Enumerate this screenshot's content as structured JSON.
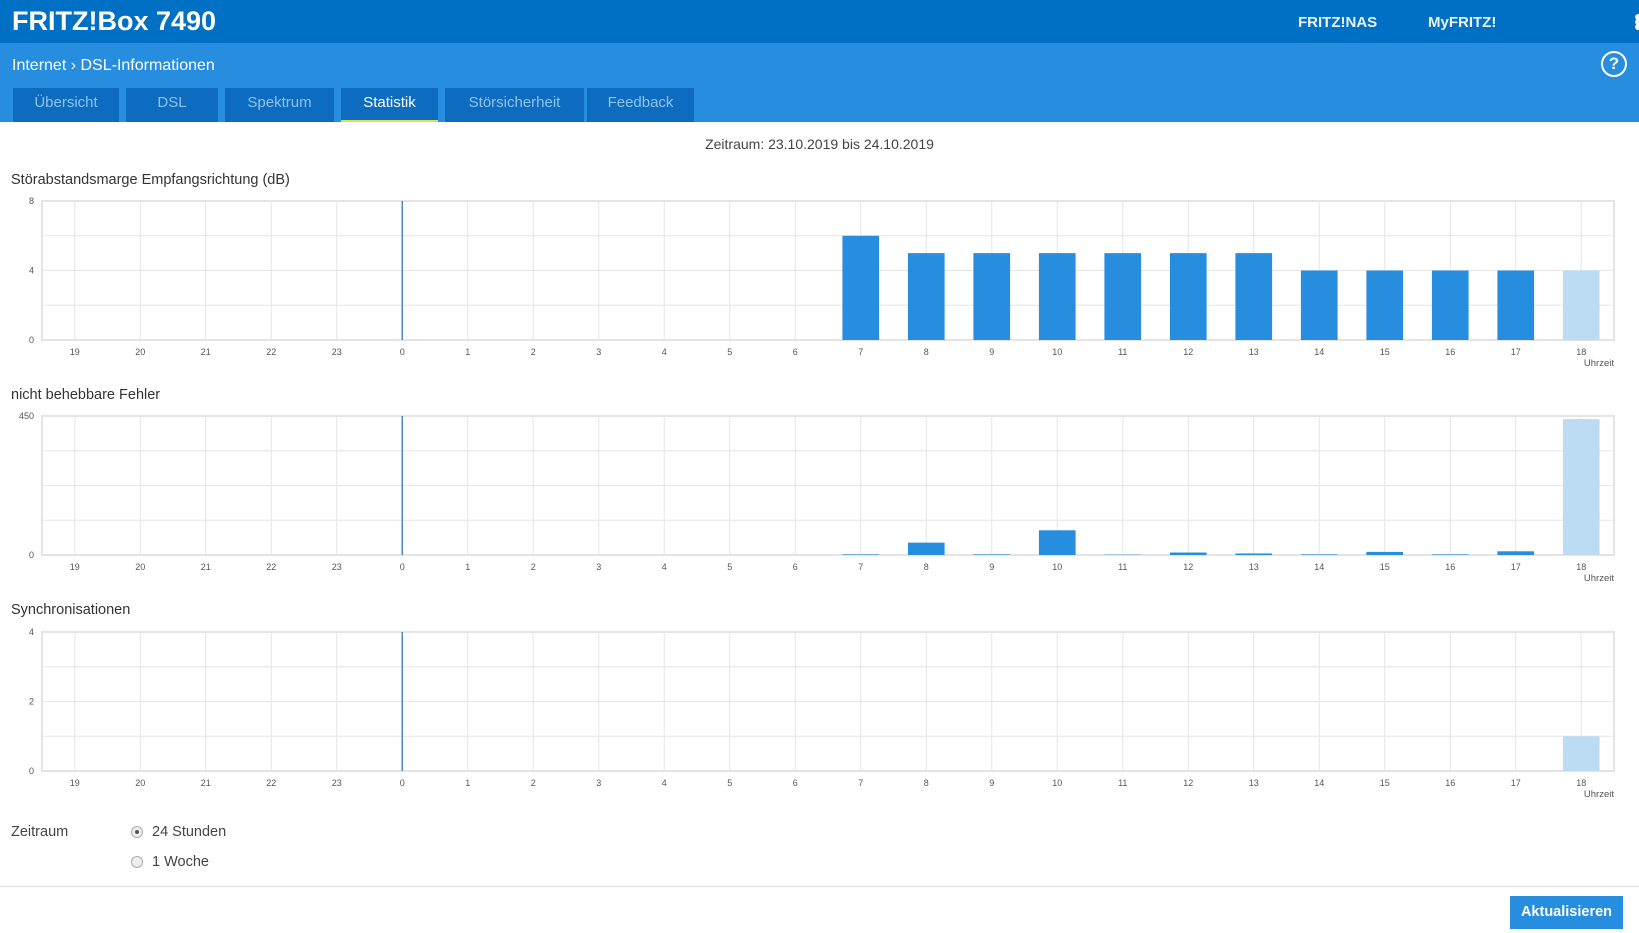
{
  "header": {
    "brand": "FRITZ!Box 7490",
    "links": [
      "FRITZ!NAS",
      "MyFRITZ!"
    ]
  },
  "breadcrumb": {
    "parent": "Internet",
    "separator": "›",
    "current": "DSL-Informationen"
  },
  "tabs": [
    {
      "label": "Übersicht"
    },
    {
      "label": "DSL"
    },
    {
      "label": "Spektrum"
    },
    {
      "label": "Statistik",
      "active": true
    },
    {
      "label": "Störsicherheit"
    },
    {
      "label": "Feedback"
    }
  ],
  "period_text": "Zeitraum: 23.10.2019 bis 24.10.2019",
  "colors": {
    "bar": "#278dde",
    "current": "#bcdcf4",
    "midnight": "#4a8ac4"
  },
  "chart_data": [
    {
      "type": "bar",
      "title": "Störabstandsmarge Empfangsrichtung (dB)",
      "xlabel": "Uhrzeit",
      "ylim": [
        0,
        8
      ],
      "yticks": [
        "0",
        "4",
        "8"
      ],
      "categories": [
        "19",
        "20",
        "21",
        "22",
        "23",
        "0",
        "1",
        "2",
        "3",
        "4",
        "5",
        "6",
        "7",
        "8",
        "9",
        "10",
        "11",
        "12",
        "13",
        "14",
        "15",
        "16",
        "17",
        "18"
      ],
      "values": [
        0,
        0,
        0,
        0,
        0,
        0,
        0,
        0,
        0,
        0,
        0,
        0,
        6,
        5,
        5,
        5,
        5,
        5,
        5,
        4,
        4,
        4,
        4,
        4
      ],
      "current_index": 23
    },
    {
      "type": "bar",
      "title": "nicht behebbare Fehler",
      "xlabel": "Uhrzeit",
      "ylim": [
        0,
        450
      ],
      "yticks": [
        "0",
        "450"
      ],
      "categories": [
        "19",
        "20",
        "21",
        "22",
        "23",
        "0",
        "1",
        "2",
        "3",
        "4",
        "5",
        "6",
        "7",
        "8",
        "9",
        "10",
        "11",
        "12",
        "13",
        "14",
        "15",
        "16",
        "17",
        "18"
      ],
      "values": [
        0,
        0,
        0,
        0,
        0,
        0,
        0,
        0,
        0,
        0,
        0,
        0,
        2,
        40,
        2,
        80,
        1,
        8,
        5,
        2,
        10,
        2,
        12,
        440
      ],
      "current_index": 23
    },
    {
      "type": "bar",
      "title": "Synchronisationen",
      "xlabel": "Uhrzeit",
      "ylim": [
        0,
        4
      ],
      "yticks": [
        "0",
        "2",
        "4"
      ],
      "categories": [
        "19",
        "20",
        "21",
        "22",
        "23",
        "0",
        "1",
        "2",
        "3",
        "4",
        "5",
        "6",
        "7",
        "8",
        "9",
        "10",
        "11",
        "12",
        "13",
        "14",
        "15",
        "16",
        "17",
        "18"
      ],
      "values": [
        0,
        0,
        0,
        0,
        0,
        0,
        0,
        0,
        0,
        0,
        0,
        0,
        0,
        0,
        0,
        0,
        0,
        0,
        0,
        0,
        0,
        0,
        0,
        1
      ],
      "current_index": 23
    }
  ],
  "zeitraum": {
    "label": "Zeitraum",
    "options": [
      {
        "label": "24 Stunden",
        "checked": true
      },
      {
        "label": "1 Woche",
        "checked": false
      }
    ]
  },
  "refresh_button": "Aktualisieren"
}
